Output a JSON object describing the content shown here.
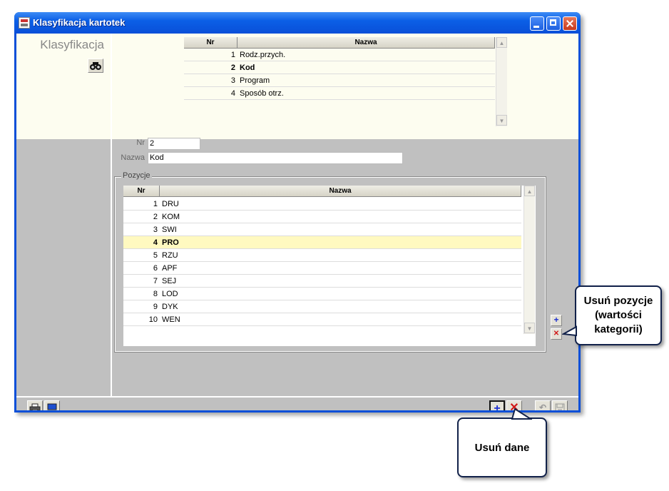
{
  "window": {
    "title": "Klasyfikacja kartotek"
  },
  "left_panel": {
    "title": "Klasyfikacja",
    "search_icon": "binoculars-icon"
  },
  "categories": {
    "headers": {
      "nr": "Nr",
      "name": "Nazwa"
    },
    "rows": [
      {
        "nr": "1",
        "name": "Rodz.przych."
      },
      {
        "nr": "2",
        "name": "Kod",
        "selected": true
      },
      {
        "nr": "3",
        "name": "Program"
      },
      {
        "nr": "4",
        "name": "Sposób otrz."
      }
    ]
  },
  "form": {
    "nr_label": "Nr",
    "nr_value": "2",
    "name_label": "Nazwa",
    "name_value": "Kod"
  },
  "positions": {
    "group_label": "Pozycje",
    "headers": {
      "nr": "Nr",
      "name": "Nazwa"
    },
    "rows": [
      {
        "nr": "1",
        "name": "DRU"
      },
      {
        "nr": "2",
        "name": "KOM"
      },
      {
        "nr": "3",
        "name": "SWI"
      },
      {
        "nr": "4",
        "name": "PRO",
        "selected": true
      },
      {
        "nr": "5",
        "name": "RZU"
      },
      {
        "nr": "6",
        "name": "APF"
      },
      {
        "nr": "7",
        "name": "SEJ"
      },
      {
        "nr": "8",
        "name": "LOD"
      },
      {
        "nr": "9",
        "name": "DYK"
      },
      {
        "nr": "10",
        "name": "WEN"
      }
    ]
  },
  "side_buttons": {
    "add": "+",
    "remove": "✕"
  },
  "toolbar": {
    "print_icon": "printer-icon",
    "preview_icon": "monitor-icon",
    "add": "+",
    "delete": "✕",
    "undo_icon": "undo-icon",
    "save_icon": "save-icon"
  },
  "callouts": {
    "remove_positions": "Usuń pozycje (wartości kategorii)",
    "remove_data": "Usuń dane"
  },
  "colors": {
    "title_bar": "#0a4fd8",
    "panel": "#fdfdf0",
    "selected_row": "#fff9c0",
    "add_blue": "#1d2fd0",
    "delete_red": "#d01818"
  }
}
